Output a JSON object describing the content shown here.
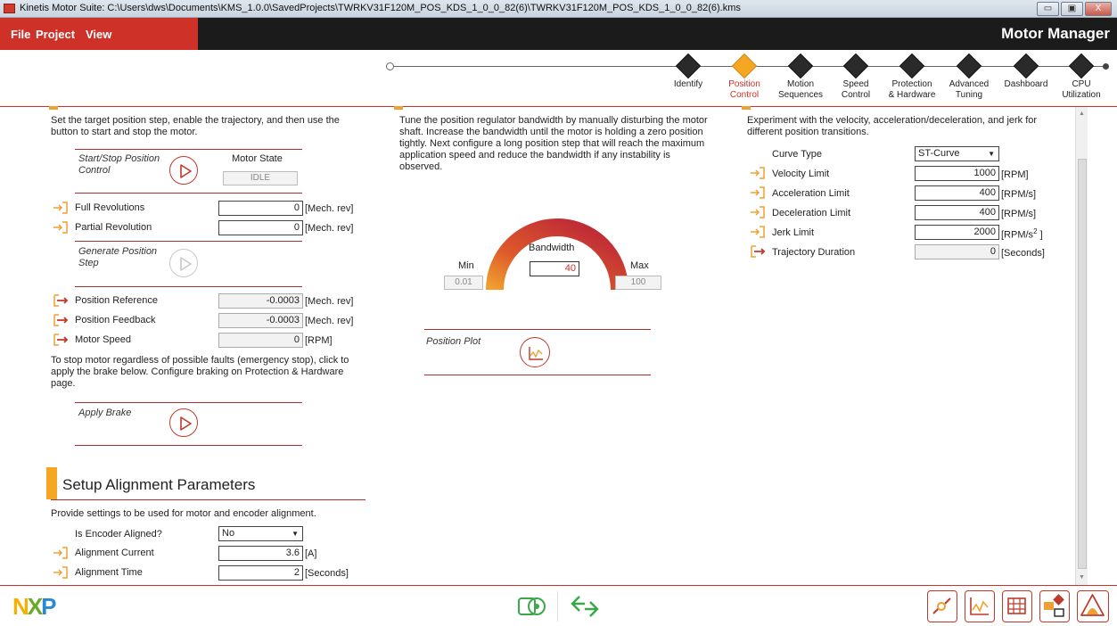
{
  "window": {
    "title": "Kinetis Motor Suite: C:\\Users\\dws\\Documents\\KMS_1.0.0\\SavedProjects\\TWRKV31F120M_POS_KDS_1_0_0_82(6)\\TWRKV31F120M_POS_KDS_1_0_0_82(6).kms",
    "minimize": "▭",
    "maximize": "▣",
    "close": "X"
  },
  "menu": {
    "file": "File",
    "project": "Project",
    "view": "View",
    "app_name": "Motor Manager"
  },
  "nav": {
    "steps": [
      {
        "label1": "Identify",
        "label2": ""
      },
      {
        "label1": "Position",
        "label2": "Control"
      },
      {
        "label1": "Motion",
        "label2": "Sequences"
      },
      {
        "label1": "Speed",
        "label2": "Control"
      },
      {
        "label1": "Protection",
        "label2": "& Hardware"
      },
      {
        "label1": "Advanced",
        "label2": "Tuning"
      },
      {
        "label1": "Dashboard",
        "label2": ""
      },
      {
        "label1": "CPU",
        "label2": "Utilization"
      }
    ]
  },
  "left": {
    "desc": "Set the target position step, enable the trajectory, and then use the button to start and stop the motor.",
    "start_stop_label": "Start/Stop Position Control",
    "motor_state_label": "Motor State",
    "motor_state_value": "IDLE",
    "full_rev_label": "Full Revolutions",
    "full_rev_value": "0",
    "full_rev_unit": "[Mech. rev]",
    "partial_rev_label": "Partial Revolution",
    "partial_rev_value": "0",
    "partial_rev_unit": "[Mech. rev]",
    "gen_step_label": "Generate Position Step",
    "pos_ref_label": "Position Reference",
    "pos_ref_value": "-0.0003",
    "pos_ref_unit": "[Mech. rev]",
    "pos_fb_label": "Position Feedback",
    "pos_fb_value": "-0.0003",
    "pos_fb_unit": "[Mech. rev]",
    "motor_speed_label": "Motor Speed",
    "motor_speed_value": "0",
    "motor_speed_unit": "[RPM]",
    "brake_desc": "To stop motor regardless of possible faults (emergency stop), click to apply the brake below. Configure braking on Protection & Hardware page.",
    "apply_brake_label": "Apply Brake",
    "align_title": "Setup Alignment Parameters",
    "align_desc": "Provide settings to be used for motor and encoder alignment.",
    "encoder_aligned_label": "Is Encoder Aligned?",
    "encoder_aligned_value": "No",
    "align_current_label": "Alignment Current",
    "align_current_value": "3.6",
    "align_current_unit": "[A]",
    "align_time_label": "Alignment Time",
    "align_time_value": "2",
    "align_time_unit": "[Seconds]"
  },
  "middle": {
    "desc": "Tune the position regulator bandwidth by manually disturbing the motor shaft. Increase the bandwidth until the motor is holding a zero position tightly. Next configure a long position step that will reach the maximum application speed and reduce the bandwidth if any instability is observed.",
    "bandwidth_label": "Bandwidth",
    "bandwidth_value": "40",
    "min_label": "Min",
    "min_value": "0.01",
    "max_label": "Max",
    "max_value": "100",
    "position_plot_label": "Position Plot"
  },
  "right": {
    "desc": "Experiment with the velocity, acceleration/deceleration, and jerk for different position transitions.",
    "curve_type_label": "Curve Type",
    "curve_type_value": "ST-Curve",
    "velocity_label": "Velocity Limit",
    "velocity_value": "1000",
    "velocity_unit": "[RPM]",
    "accel_label": "Acceleration Limit",
    "accel_value": "400",
    "accel_unit": "[RPM/s]",
    "decel_label": "Deceleration Limit",
    "decel_value": "400",
    "decel_unit": "[RPM/s]",
    "jerk_label": "Jerk Limit",
    "jerk_value": "2000",
    "jerk_unit": "[RPM/s",
    "jerk_unit_sup": "2",
    "jerk_unit_end": " ]",
    "traj_label": "Trajectory Duration",
    "traj_value": "0",
    "traj_unit": "[Seconds]"
  },
  "footer": {
    "logo": "NXP"
  },
  "colors": {
    "accent_red": "#cd3127",
    "accent_orange": "#f5a623",
    "dark": "#1b1b1b"
  }
}
